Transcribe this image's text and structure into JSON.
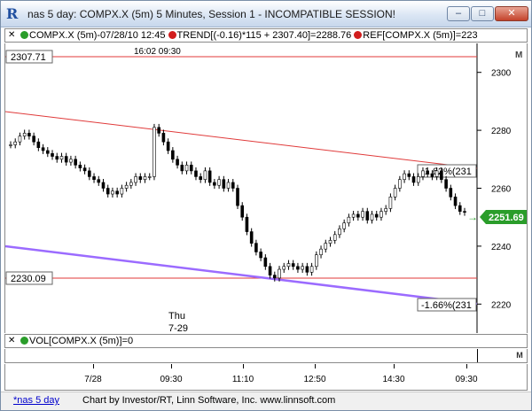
{
  "window": {
    "title": "nas 5 day: COMPX.X (5m) 5 Minutes, Session 1 - INCOMPATIBLE SESSION!",
    "minimize_glyph": "–",
    "maximize_glyph": "□",
    "close_glyph": "✕",
    "app_icon": "R"
  },
  "legend": {
    "close_glyph": "✕",
    "items": [
      {
        "color": "#2a9d2a",
        "text": "COMPX.X (5m)-07/28/10 12:45"
      },
      {
        "color": "#d21d1d",
        "text": "TREND[(-0.16)*115 + 2307.40]=2288.76"
      },
      {
        "color": "#d21d1d",
        "text": "REF[COMPX.X (5m)]=223"
      }
    ]
  },
  "chart_labels": {
    "top_time": "16:02  09:30",
    "day_label_line1": "Thu",
    "day_label_line2": "7-29",
    "ref_top": "2307.71",
    "ref_bottom": "2230.09",
    "trend_upper_pct": "-1.62%(231",
    "trend_lower_pct": "-1.66%(231",
    "current_price": "2251.69",
    "m_marker": "M"
  },
  "price_axis": {
    "ticks": [
      "2300",
      "2280",
      "2260",
      "2240",
      "2220"
    ]
  },
  "volume": {
    "close_glyph": "✕",
    "color": "#2a9d2a",
    "label": "VOL[COMPX.X (5m)]=0",
    "m_marker": "M"
  },
  "time_axis": {
    "labels": [
      "7/28",
      "09:30",
      "11:10",
      "12:50",
      "14:30",
      "09:30"
    ]
  },
  "status": {
    "tab": "*nas 5 day",
    "credit": "Chart by Investor/RT, Linn Software, Inc. www.linnsoft.com"
  },
  "colors": {
    "reference_line": "#e03a3a",
    "trend_upper": "#e03a3a",
    "trend_lower": "#9b6bff",
    "price_tag": "#2a9d2a"
  },
  "chart_data": {
    "type": "candlestick",
    "y_axis_range": [
      2210,
      2310
    ],
    "ref_levels": [
      2307.71,
      2230.09
    ],
    "last": 2251.69,
    "closes": [
      2275,
      2276,
      2278,
      2279,
      2278,
      2276,
      2274,
      2273,
      2272,
      2271,
      2270,
      2271,
      2269,
      2270,
      2268,
      2267,
      2266,
      2264,
      2263,
      2262,
      2260,
      2258,
      2259,
      2258,
      2260,
      2261,
      2262,
      2264,
      2263,
      2264,
      2264,
      2281,
      2279,
      2276,
      2273,
      2270,
      2268,
      2266,
      2268,
      2266,
      2264,
      2263,
      2266,
      2262,
      2261,
      2263,
      2260,
      2262,
      2260,
      2254,
      2250,
      2245,
      2241,
      2238,
      2236,
      2233,
      2230,
      2229,
      2232,
      2233,
      2234,
      2233,
      2232,
      2233,
      2231,
      2233,
      2237,
      2239,
      2241,
      2242,
      2244,
      2246,
      2248,
      2250,
      2251,
      2250,
      2252,
      2249,
      2251,
      2250,
      2252,
      2253,
      2257,
      2260,
      2263,
      2265,
      2264,
      2262,
      2264,
      2266,
      2265,
      2264,
      2266,
      2263,
      2260,
      2257,
      2254,
      2252,
      2251.69
    ]
  }
}
